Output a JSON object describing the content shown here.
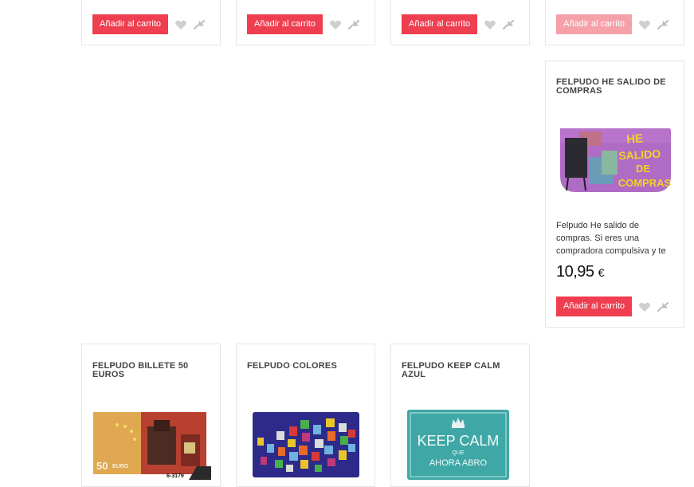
{
  "top_row": {
    "cards": [
      {
        "add_to_cart": "Añadir al carrito",
        "wishlist_icon": "heart-icon",
        "compare_icon": "compare-arrows-icon"
      },
      {
        "add_to_cart": "Añadir al carrito",
        "wishlist_icon": "heart-icon",
        "compare_icon": "compare-arrows-icon"
      },
      {
        "add_to_cart": "Añadir al carrito",
        "wishlist_icon": "heart-icon",
        "compare_icon": "compare-arrows-icon"
      },
      {
        "add_to_cart": "Añadir al carrito",
        "wishlist_icon": "heart-icon",
        "compare_icon": "compare-arrows-icon"
      }
    ]
  },
  "featured": {
    "title": "FELPUDO HE SALIDO DE COMPRAS",
    "image_text": [
      "HE",
      "SALIDO",
      "DE",
      "COMPRAS"
    ],
    "description": "Felpudo He salido de compras. Si eres una compradora compulsiva y te",
    "price": "10,95",
    "currency": "€",
    "add_to_cart": "Añadir al carrito"
  },
  "bottom_row": [
    {
      "title": "FELPUDO BILLETE 50 EUROS",
      "image_text": [
        "50",
        "EURO",
        "6-3179"
      ]
    },
    {
      "title": "FELPUDO COLORES"
    },
    {
      "title": "FELPUDO KEEP CALM AZUL",
      "image_text": [
        "KEEP CALM",
        "QUE",
        "AHORA ABRO"
      ]
    }
  ],
  "colors": {
    "button": "#ef3e4f",
    "button_faded": "#f6a1aa",
    "border": "#e6e6e6",
    "icon": "#c8c8c8"
  }
}
